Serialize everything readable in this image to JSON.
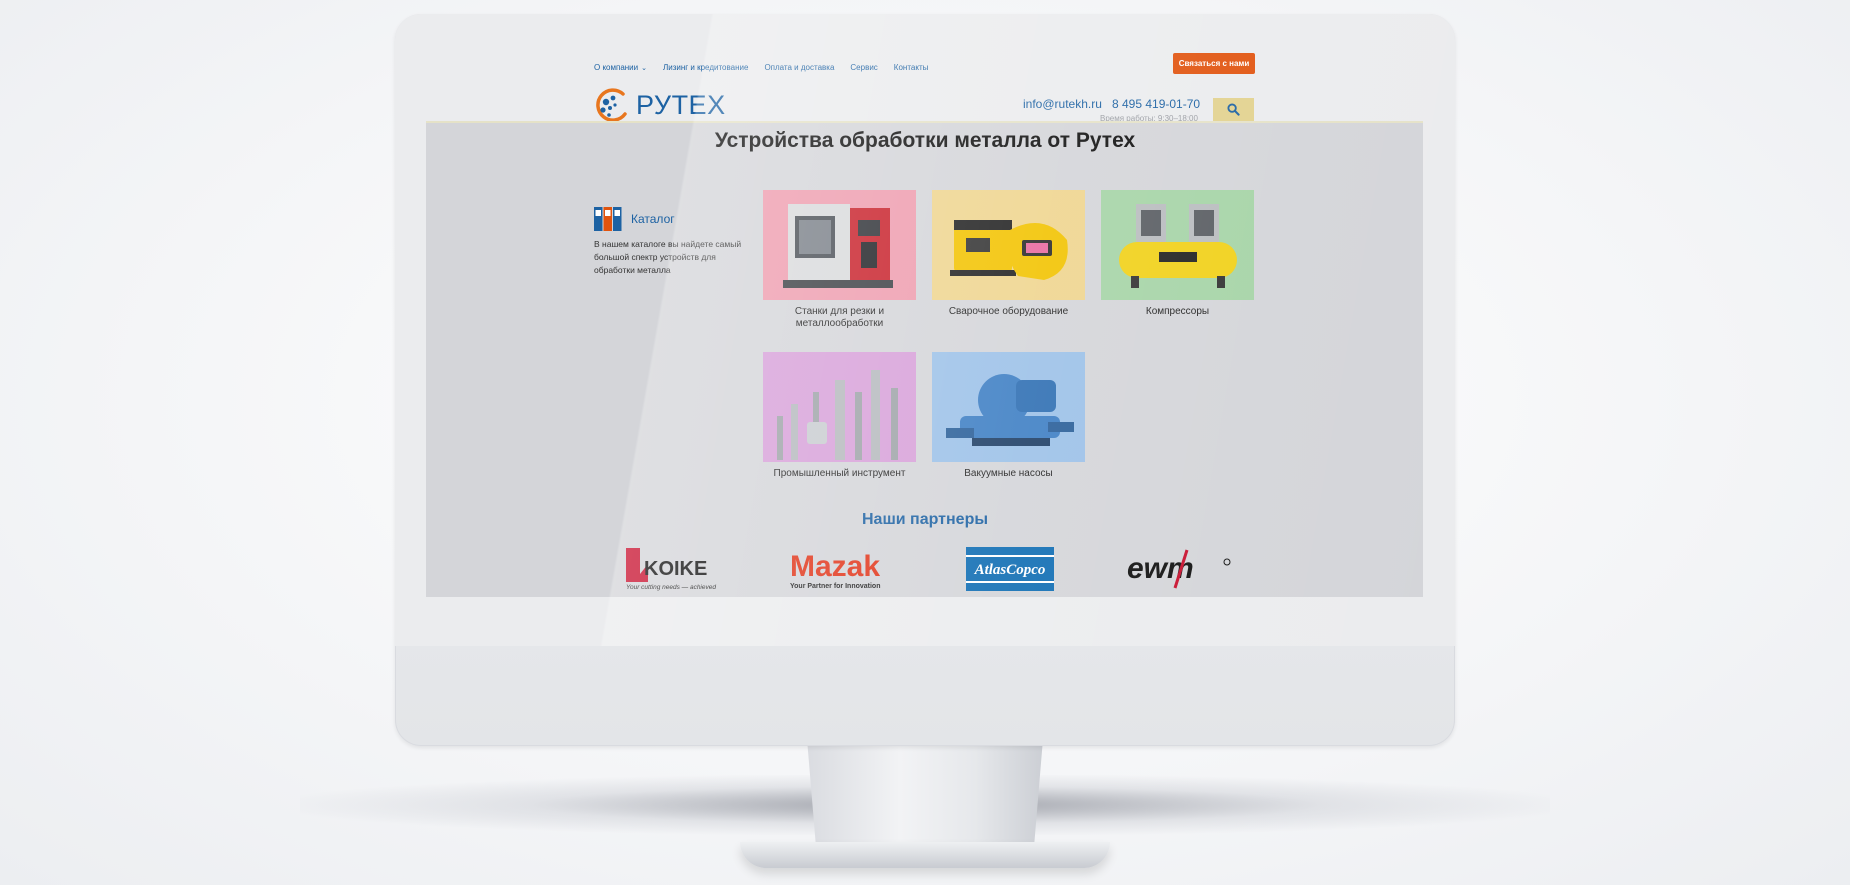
{
  "nav": {
    "items": [
      {
        "label": "О компании",
        "has_dropdown": true
      },
      {
        "label": "Лизинг и кредитование"
      },
      {
        "label": "Оплата и доставка"
      },
      {
        "label": "Сервис"
      },
      {
        "label": "Контакты"
      }
    ],
    "contact_button": "Связаться с нами"
  },
  "header": {
    "logo_text": "РУТЕХ",
    "email": "info@rutekh.ru",
    "phone": "8 495 419-01-70",
    "hours": "Время работы: 9:30–18:00",
    "search_icon": "search-icon"
  },
  "main": {
    "title": "Устройства обработки металла от Рутех",
    "catalog": {
      "title": "Каталог",
      "description": "В нашем каталоге вы найдете самый большой спектр устройств для обработки металла"
    },
    "categories": [
      {
        "label": "Станки для резки и металлообработки",
        "bg": "#ee9cae"
      },
      {
        "label": "Сварочное оборудование",
        "bg": "#efd58f"
      },
      {
        "label": "Компрессоры",
        "bg": "#a6d4a7"
      },
      {
        "label": "Промышленный инструмент",
        "bg": "#d7a0d9"
      },
      {
        "label": "Вакуумные насосы",
        "bg": "#9cc1e8"
      }
    ]
  },
  "partners": {
    "title": "Наши партнеры",
    "logos": [
      {
        "name": "KOIKE",
        "tagline": "Your cutting needs — achieved"
      },
      {
        "name": "Mazak",
        "tagline": "Your Partner for Innovation"
      },
      {
        "name": "AtlasCopco"
      },
      {
        "name": "ewm"
      }
    ]
  },
  "colors": {
    "accent": "#1d62a3",
    "cta": "#e1540f",
    "search_bg": "#e2d28f"
  }
}
